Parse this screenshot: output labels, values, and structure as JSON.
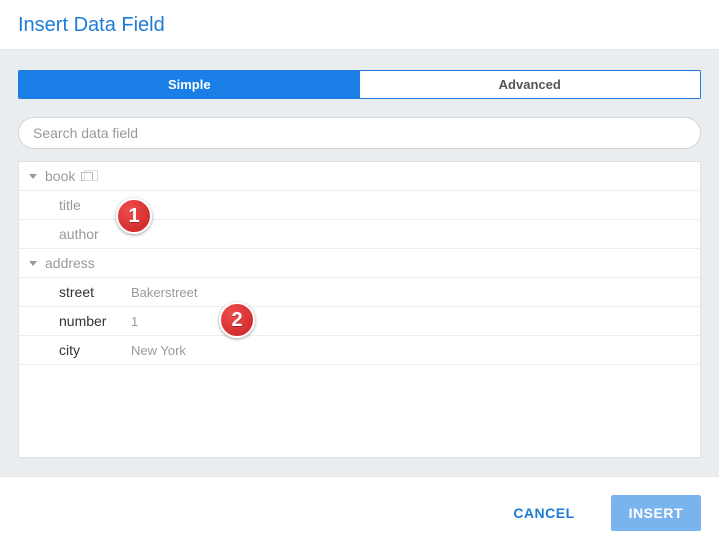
{
  "header": {
    "title": "Insert Data Field"
  },
  "tabs": {
    "simple": "Simple",
    "advanced": "Advanced"
  },
  "search": {
    "placeholder": "Search data field"
  },
  "tree": {
    "groups": [
      {
        "name": "book",
        "repeatable": true,
        "children": [
          {
            "label": "title",
            "value": ""
          },
          {
            "label": "author",
            "value": ""
          }
        ]
      },
      {
        "name": "address",
        "repeatable": false,
        "children": [
          {
            "label": "street",
            "value": "Bakerstreet"
          },
          {
            "label": "number",
            "value": "1"
          },
          {
            "label": "city",
            "value": "New York"
          }
        ]
      }
    ]
  },
  "footer": {
    "cancel": "Cancel",
    "insert": "Insert"
  },
  "annotations": {
    "one": "1",
    "two": "2"
  }
}
